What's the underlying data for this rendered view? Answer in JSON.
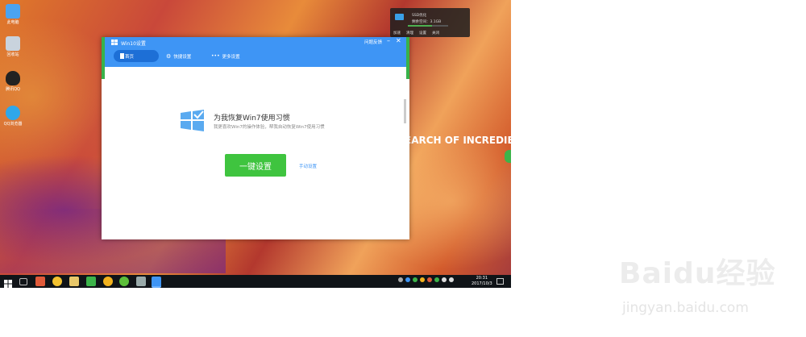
{
  "desktop": {
    "icons": [
      {
        "label": "此电脑",
        "icon": "computer-icon",
        "color": "#4aa3f0"
      },
      {
        "label": "回收站",
        "icon": "recycle-bin-icon",
        "color": "#c9d3dd"
      },
      {
        "label": "腾讯QQ",
        "icon": "qq-penguin-icon",
        "color": "#222222"
      },
      {
        "label": "QQ浏览器",
        "icon": "qq-browser-icon",
        "color": "#2fa7ea"
      }
    ],
    "overlay_text": "EARCH OF INCREDIBLE"
  },
  "widget": {
    "title": "SSD优化",
    "space": "剩余空间：3.1GB",
    "progress": 0.6,
    "actions": [
      "加速",
      "清理",
      "设置",
      "关闭"
    ]
  },
  "window": {
    "title": "Win10设置",
    "feedback": "问题反馈",
    "minimize": "–",
    "close": "✕",
    "nav": {
      "home": "首页",
      "quick": "快捷设置",
      "more": "更多设置"
    },
    "heading": "为我恢复Win7使用习惯",
    "subheading": "我更喜欢Win7的操作体验，帮我自动恢复Win7使用习惯",
    "primary_button": "一键设置",
    "manual_link": "手动设置"
  },
  "taskbar": {
    "time": "20:31",
    "date": "2017/10/3"
  },
  "watermark": {
    "logo": "Baidu经验",
    "url": "jingyan.baidu.com"
  }
}
